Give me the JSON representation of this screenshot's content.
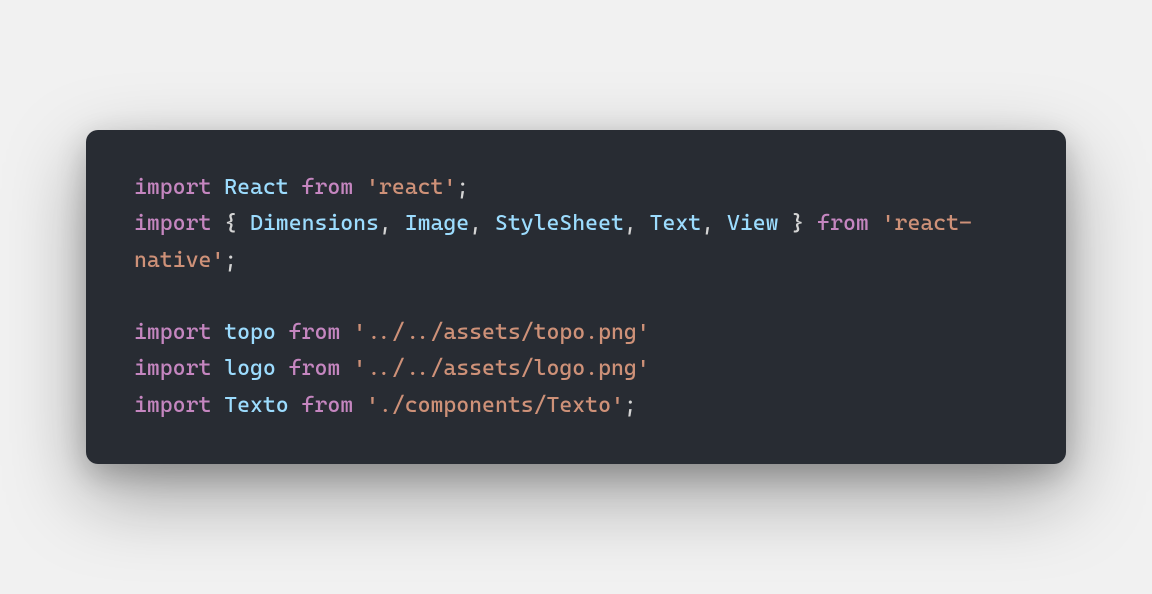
{
  "code": {
    "lines": [
      [
        {
          "t": "import ",
          "cls": "tok-keyword"
        },
        {
          "t": "React",
          "cls": "tok-ident"
        },
        {
          "t": " from ",
          "cls": "tok-keyword"
        },
        {
          "t": "'react'",
          "cls": "tok-string"
        },
        {
          "t": ";",
          "cls": "tok-punct"
        }
      ],
      [
        {
          "t": "import ",
          "cls": "tok-keyword"
        },
        {
          "t": "{ ",
          "cls": "tok-punct"
        },
        {
          "t": "Dimensions",
          "cls": "tok-ident"
        },
        {
          "t": ", ",
          "cls": "tok-punct"
        },
        {
          "t": "Image",
          "cls": "tok-ident"
        },
        {
          "t": ", ",
          "cls": "tok-punct"
        },
        {
          "t": "StyleSheet",
          "cls": "tok-ident"
        },
        {
          "t": ", ",
          "cls": "tok-punct"
        },
        {
          "t": "Text",
          "cls": "tok-ident"
        },
        {
          "t": ", ",
          "cls": "tok-punct"
        },
        {
          "t": "View",
          "cls": "tok-ident"
        },
        {
          "t": " }",
          "cls": "tok-punct"
        },
        {
          "t": " from ",
          "cls": "tok-keyword"
        },
        {
          "t": "'react-native'",
          "cls": "tok-string"
        },
        {
          "t": ";",
          "cls": "tok-punct"
        }
      ],
      [],
      [
        {
          "t": "import ",
          "cls": "tok-keyword"
        },
        {
          "t": "topo",
          "cls": "tok-ident"
        },
        {
          "t": " from ",
          "cls": "tok-keyword"
        },
        {
          "t": "'../../assets/topo.png'",
          "cls": "tok-string"
        }
      ],
      [
        {
          "t": "import ",
          "cls": "tok-keyword"
        },
        {
          "t": "logo",
          "cls": "tok-ident"
        },
        {
          "t": " from ",
          "cls": "tok-keyword"
        },
        {
          "t": "'../../assets/logo.png'",
          "cls": "tok-string"
        }
      ],
      [
        {
          "t": "import ",
          "cls": "tok-keyword"
        },
        {
          "t": "Texto",
          "cls": "tok-ident"
        },
        {
          "t": " from ",
          "cls": "tok-keyword"
        },
        {
          "t": "'./components/Texto'",
          "cls": "tok-string"
        },
        {
          "t": ";",
          "cls": "tok-punct"
        }
      ]
    ]
  },
  "colors": {
    "bg_page": "#f1f1f1",
    "bg_card": "#282c33",
    "keyword": "#c586c0",
    "identifier": "#9cdcfe",
    "string": "#ce9178",
    "punct": "#d4d4d4"
  }
}
